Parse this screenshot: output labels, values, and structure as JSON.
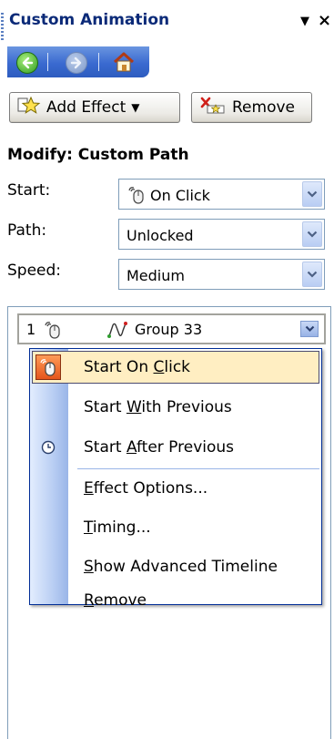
{
  "pane": {
    "title": "Custom Animation",
    "title_dropdown_icon": "down-triangle-icon",
    "close_icon": "close-icon",
    "close_glyph": "×"
  },
  "nav": {
    "back_icon": "back-arrow-icon",
    "forward_icon": "forward-arrow-icon",
    "home_icon": "home-icon"
  },
  "toolbar": {
    "add_effect_label": "Add Effect",
    "add_effect_icon": "star-icon",
    "remove_label": "Remove",
    "remove_icon": "remove-x-icon"
  },
  "modify": {
    "header": "Modify: Custom Path",
    "start": {
      "label": "Start:",
      "value": "On Click",
      "icon": "mouse-icon"
    },
    "path": {
      "label": "Path:",
      "value": "Unlocked"
    },
    "speed": {
      "label": "Speed:",
      "value": "Medium"
    }
  },
  "effect_list": {
    "items": [
      {
        "number": "1",
        "trigger_icon": "mouse-icon",
        "type_icon": "custom-path-icon",
        "name": "Group 33"
      }
    ]
  },
  "context_menu": {
    "items": [
      {
        "pre": "Start On ",
        "key": "C",
        "post": "lick",
        "icon": "mouse-icon",
        "highlighted": true
      },
      {
        "pre": "Start ",
        "key": "W",
        "post": "ith Previous",
        "icon": "",
        "highlighted": false
      },
      {
        "pre": "Start ",
        "key": "A",
        "post": "fter Previous",
        "icon": "clock-icon",
        "highlighted": false
      },
      {
        "pre": "",
        "key": "E",
        "post": "ffect Options...",
        "icon": "",
        "highlighted": false
      },
      {
        "pre": "",
        "key": "T",
        "post": "iming...",
        "icon": "",
        "highlighted": false
      },
      {
        "pre": "",
        "key": "S",
        "post": "how Advanced Timeline",
        "icon": "",
        "highlighted": false
      },
      {
        "pre": "",
        "key": "R",
        "post": "emove",
        "icon": "",
        "highlighted": false
      }
    ]
  },
  "colors": {
    "title_text": "#0b2a78",
    "menu_highlight": "#ffeec2",
    "menu_border": "#002d96",
    "nav_bar": "#3a6ad0"
  }
}
